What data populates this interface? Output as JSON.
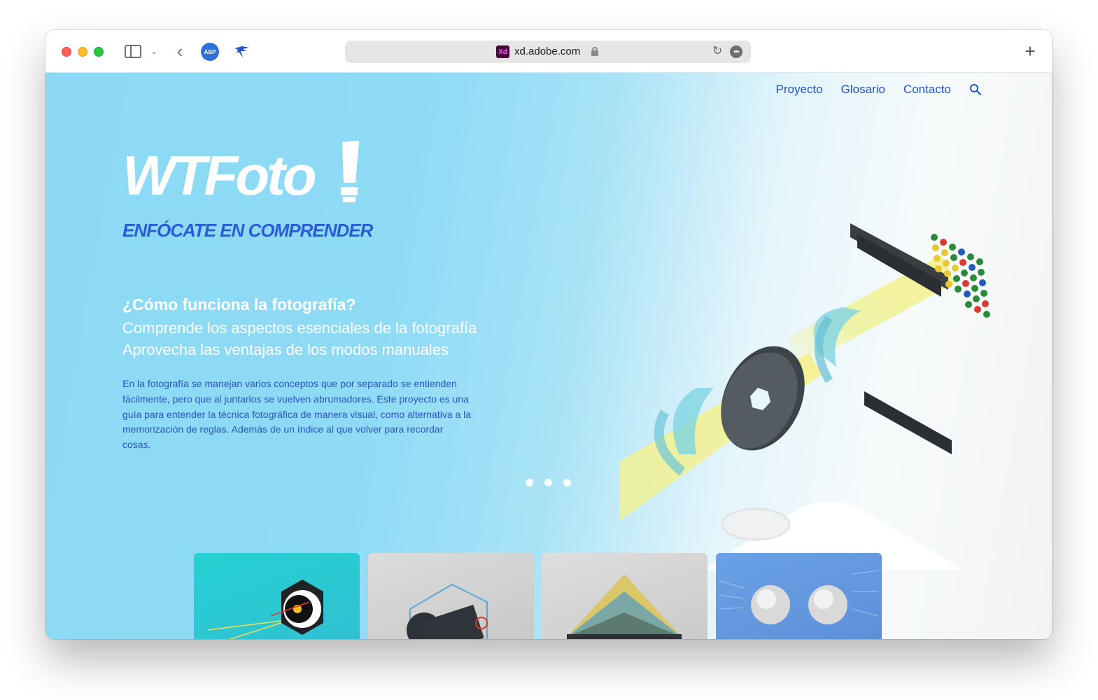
{
  "browser": {
    "url": "xd.adobe.com",
    "site_badge": "Xd",
    "abp_label": "ABP"
  },
  "nav": {
    "items": [
      "Proyecto",
      "Glosario",
      "Contacto"
    ]
  },
  "hero": {
    "logo": "WTFoto",
    "tagline": "ENFÓCATE EN COMPRENDER",
    "headline": "¿Cómo funciona la fotografía?",
    "sub1": "Comprende los aspectos esenciales de la fotografía",
    "sub2": "Aprovecha las ventajas de los modos manuales",
    "body": "En la fotografía se manejan varios conceptos que por separado se entienden fácilmente, pero que al juntarlos se vuelven abrumadores. Este proyecto es una guía para entender la técnica fotográfica de manera visual, como alternativa a la memorización de reglas. Además de un índice al que volver para recordar cosas."
  },
  "carousel": {
    "slides": 3,
    "active": 0
  },
  "cards": [
    {
      "name": "lens-card",
      "color": "#26d1d3"
    },
    {
      "name": "camera-card",
      "color": "#dcdcdc"
    },
    {
      "name": "sensor-card",
      "color": "#dedede"
    },
    {
      "name": "spheres-card",
      "color": "#6aa1e6"
    }
  ],
  "colors": {
    "accent": "#2c5bd8",
    "nav_text": "#2153c9",
    "hero_bg": "#8bd9f4"
  }
}
